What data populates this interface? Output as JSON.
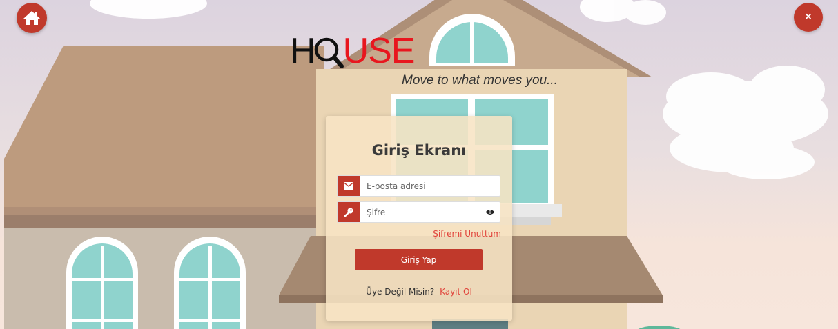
{
  "header": {
    "home_icon": "home-icon",
    "close_label": "×"
  },
  "brand": {
    "logo_part1": "H",
    "logo_part2": "USE",
    "tagline": "Move to what moves you..."
  },
  "login": {
    "title": "Giriş Ekranı",
    "email_placeholder": "E-posta adresi",
    "email_value": "",
    "password_placeholder": "Şifre",
    "password_value": "",
    "forgot_label": "Şifremi Unuttum",
    "submit_label": "Giriş Yap",
    "not_member_label": "Üye Değil Misin?",
    "signup_label": "Kayıt Ol"
  },
  "colors": {
    "accent": "#c0392b",
    "link": "#e0433a",
    "logo_red": "#e8161e"
  }
}
